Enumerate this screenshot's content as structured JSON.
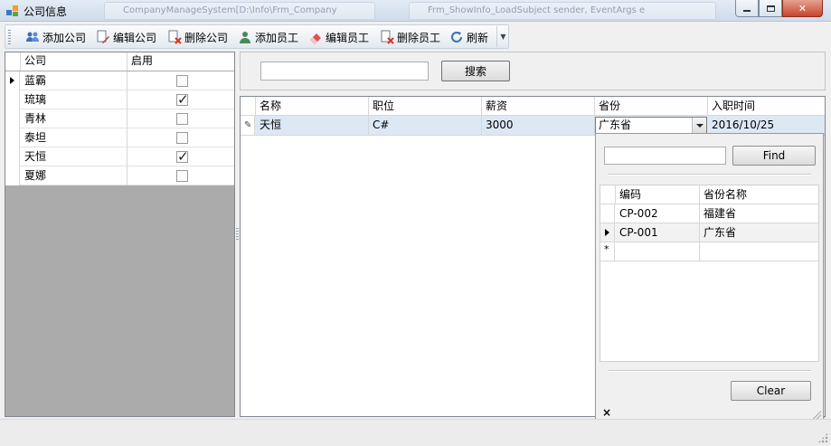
{
  "window": {
    "title": "公司信息",
    "ghost_tabs": [
      "CompanyManageSystem[D:\\Info\\Frm_Company",
      "Frm_ShowInfo_LoadSubject sender, EventArgs e"
    ]
  },
  "toolbar": {
    "add_company": "添加公司",
    "edit_company": "编辑公司",
    "delete_company": "删除公司",
    "add_employee": "添加员工",
    "edit_employee": "编辑员工",
    "delete_employee": "删除员工",
    "refresh": "刷新"
  },
  "company_grid": {
    "columns": [
      "公司",
      "启用"
    ],
    "rows": [
      {
        "name": "蓝霸",
        "enabled": false,
        "current": true
      },
      {
        "name": "琉璃",
        "enabled": true,
        "current": false
      },
      {
        "name": "青林",
        "enabled": false,
        "current": false
      },
      {
        "name": "泰坦",
        "enabled": false,
        "current": false
      },
      {
        "name": "天恒",
        "enabled": true,
        "current": false
      },
      {
        "name": "夏娜",
        "enabled": false,
        "current": false
      }
    ]
  },
  "search": {
    "input_value": "",
    "button_label": "搜索"
  },
  "employee_grid": {
    "columns": [
      "名称",
      "职位",
      "薪资",
      "省份",
      "入职时间"
    ],
    "rows": [
      {
        "name": "天恒",
        "position": "C#",
        "salary": "3000",
        "province": "广东省",
        "hire_date": "2016/10/25"
      }
    ]
  },
  "province_popup": {
    "filter_value": "",
    "find_label": "Find",
    "columns": [
      "编码",
      "省份名称"
    ],
    "rows": [
      {
        "code": "CP-002",
        "name": "福建省"
      },
      {
        "code": "CP-001",
        "name": "广东省"
      }
    ],
    "new_row_marker": "*",
    "clear_label": "Clear",
    "close_glyph": "×"
  },
  "icons": {
    "app": "app-icon",
    "add_company": "users-icon",
    "edit_company": "edit-document-icon",
    "delete_company": "delete-document-icon",
    "add_employee": "user-icon",
    "edit_employee": "eraser-icon",
    "delete_employee": "delete-document-icon",
    "refresh": "refresh-icon"
  }
}
